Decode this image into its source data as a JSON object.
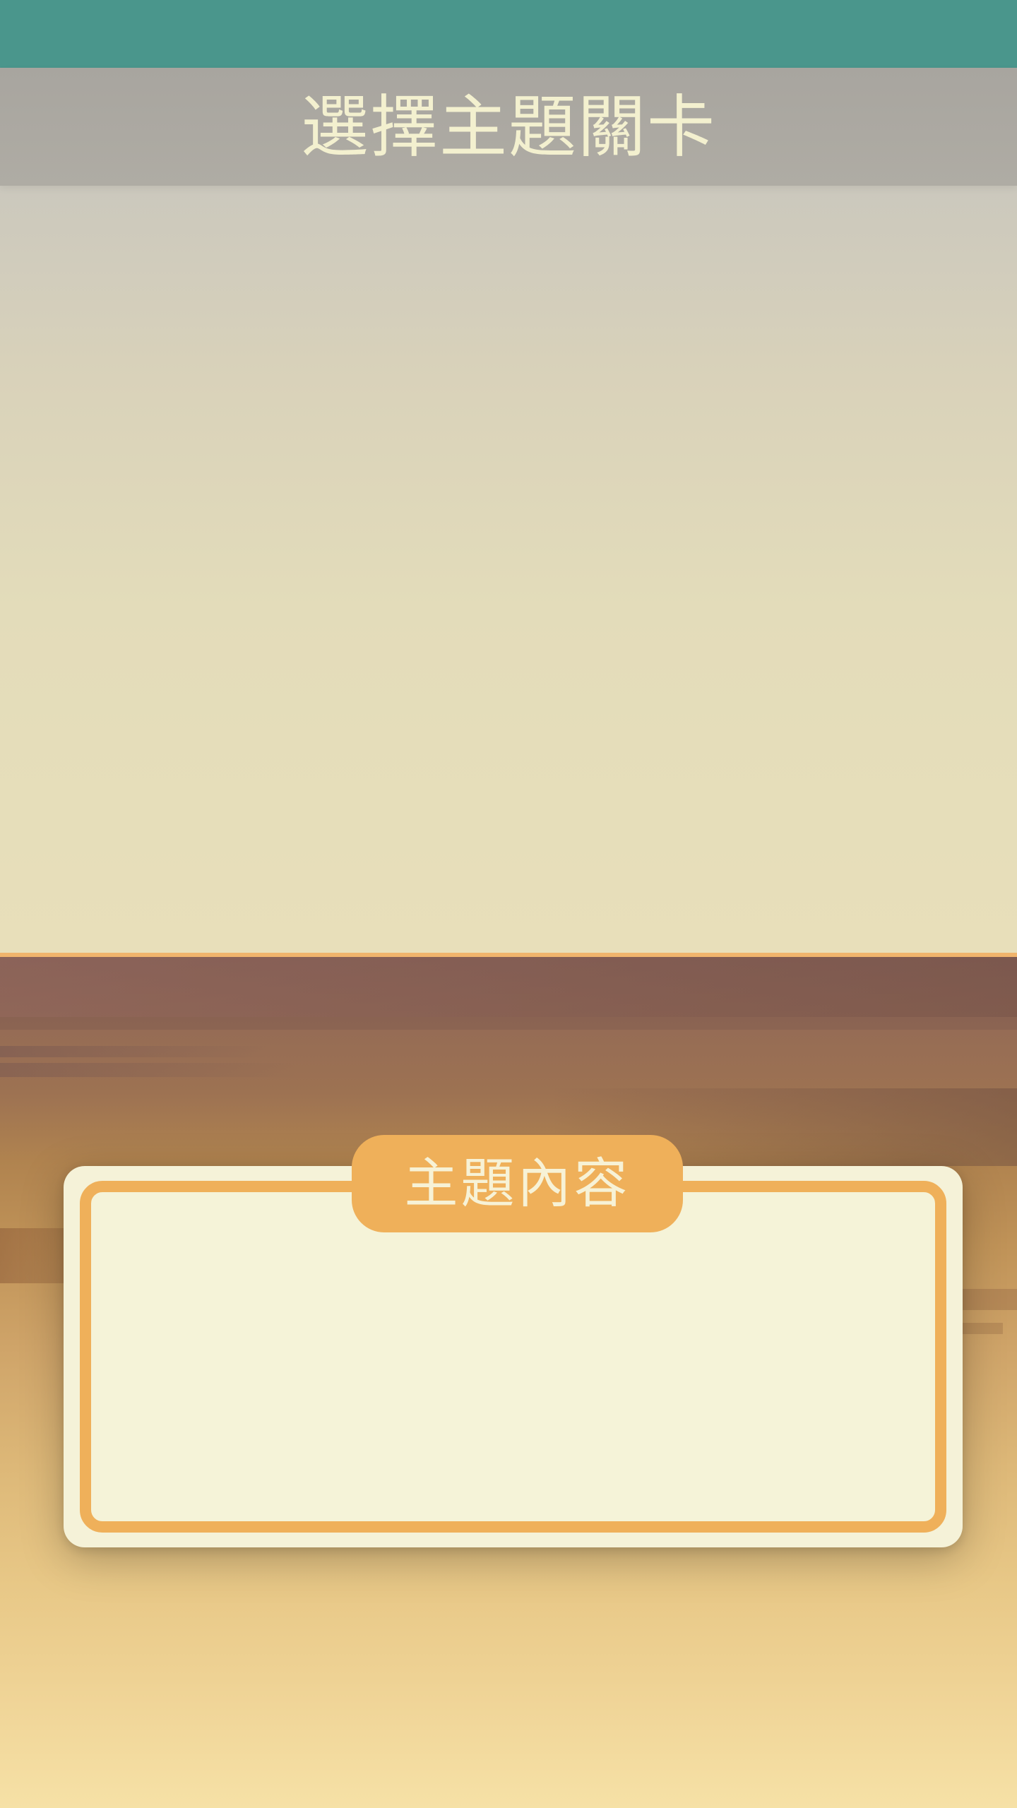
{
  "header": {
    "title": "選擇主題關卡"
  },
  "theme_panel": {
    "tab_label": "主題內容",
    "content_text": ""
  },
  "colors": {
    "status_bar": "#4a968c",
    "header_bg": "#aca99f",
    "header_text": "#f3f0cf",
    "accent_orange": "#efb05a",
    "panel_bg": "#f5f2d8"
  }
}
